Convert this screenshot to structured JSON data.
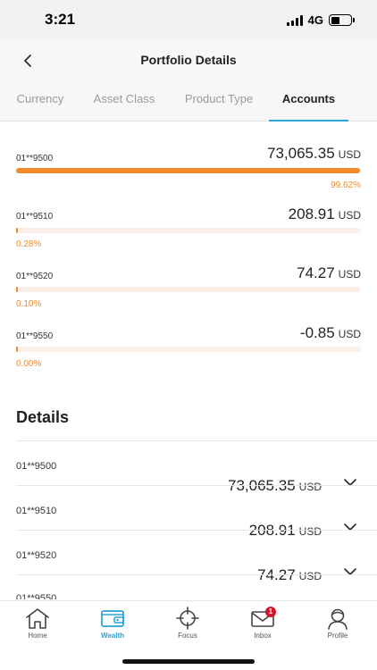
{
  "status_bar": {
    "time": "3:21",
    "network": "4G"
  },
  "header": {
    "title": "Portfolio Details"
  },
  "tabs": [
    {
      "label": "Currency",
      "active": false
    },
    {
      "label": "Asset Class",
      "active": false
    },
    {
      "label": "Product Type",
      "active": false
    },
    {
      "label": "Accounts",
      "active": true
    }
  ],
  "accounts": [
    {
      "id": "01**9500",
      "amount": "73,065.35",
      "currency": "USD",
      "percent_label": "99.62%",
      "share": 0.9962
    },
    {
      "id": "01**9510",
      "amount": "208.91",
      "currency": "USD",
      "percent_label": "0.28%",
      "share": 0.0028
    },
    {
      "id": "01**9520",
      "amount": "74.27",
      "currency": "USD",
      "percent_label": "0.10%",
      "share": 0.001
    },
    {
      "id": "01**9550",
      "amount": "-0.85",
      "currency": "USD",
      "percent_label": "0.00%",
      "share": 0.0
    }
  ],
  "details": {
    "title": "Details",
    "rows": [
      {
        "id": "01**9500",
        "amount": "73,065.35",
        "currency": "USD"
      },
      {
        "id": "01**9510",
        "amount": "208.91",
        "currency": "USD"
      },
      {
        "id": "01**9520",
        "amount": "74.27",
        "currency": "USD"
      },
      {
        "id": "01**9550",
        "amount": "",
        "currency": ""
      }
    ]
  },
  "bottom_nav": [
    {
      "label": "Home",
      "icon": "home-icon",
      "active": false
    },
    {
      "label": "Wealth",
      "icon": "wallet-icon",
      "active": true
    },
    {
      "label": "Focus",
      "icon": "crosshair-icon",
      "active": false
    },
    {
      "label": "Inbox",
      "icon": "envelope-icon",
      "active": false,
      "badge": "1"
    },
    {
      "label": "Profile",
      "icon": "profile-icon",
      "active": false
    }
  ],
  "colors": {
    "accent": "#29a3d8",
    "bar": "#f08a2b",
    "bar_track": "#fcefe8",
    "badge": "#d3152b"
  }
}
